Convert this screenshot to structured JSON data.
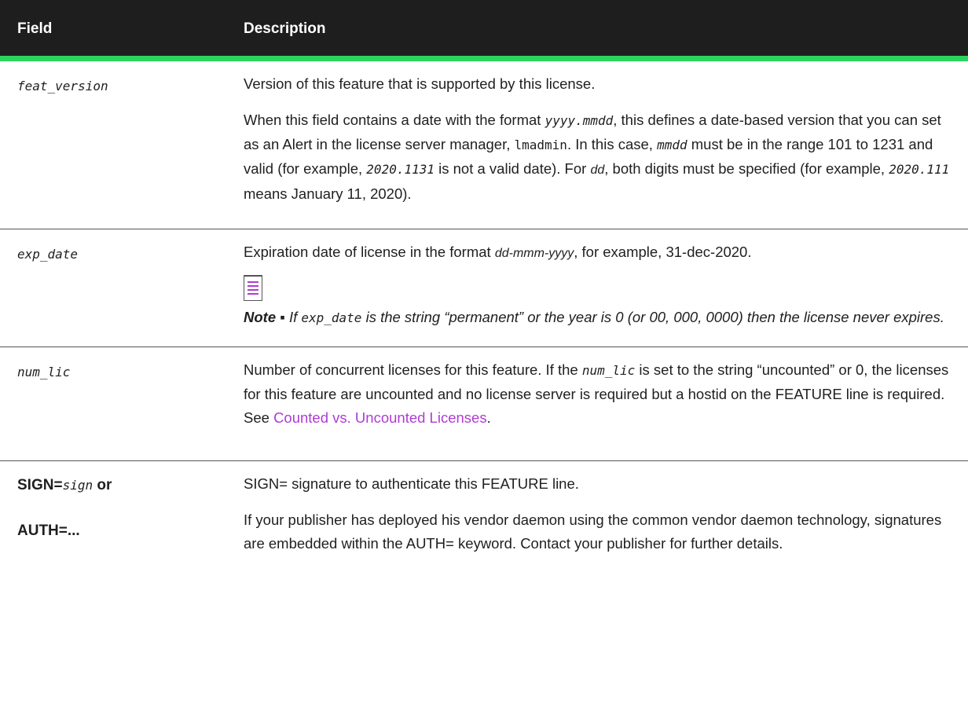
{
  "header": {
    "col_field": "Field",
    "col_description": "Description"
  },
  "rows": {
    "feat_version": {
      "field": "feat_version",
      "desc1": "Version of this feature that is supported by this license.",
      "desc2": {
        "a": "When this field contains a date with the format ",
        "fmt": "yyyy.mmdd",
        "b": ", this defines a date-based version that you can set as an Alert in the license server manager, ",
        "lmadmin": "lmadmin",
        "c": ". In this case, ",
        "mmdd": "mmdd",
        "d": "  must be in the range 101 to 1231 and valid (for example, ",
        "ex1": "2020.1131",
        "e": " is not a valid date). For ",
        "dd": "dd",
        "f": ", both digits must be specified (for example, ",
        "ex2": "2020.111",
        "g": "  means January 11, 2020)."
      }
    },
    "exp_date": {
      "field": "exp_date",
      "desc_a": "Expiration date of license in the format ",
      "fmt": "dd-mmm-yyyy",
      "desc_b": ", for example, 31-dec-2020.",
      "note_label": "Note ▪",
      "note_a": " If ",
      "note_code": "exp_date",
      "note_b": " is the string “permanent” or the year is 0 (or 00, 000, 0000) then the license never expires."
    },
    "num_lic": {
      "field": "num_lic",
      "a": "Number of concurrent licenses for this feature. If the ",
      "code": "num_lic",
      "b": " is set to the string “uncounted” or 0, the licenses for this feature are uncounted and no license server is required but a hostid on the FEATURE line is required. See ",
      "link": "Counted vs. Uncounted Licenses",
      "c": "."
    },
    "sign": {
      "field_a": "SIGN=",
      "field_b": "sign",
      "field_c": " or",
      "field2": "AUTH=...",
      "desc1": "SIGN= signature to authenticate this FEATURE line.",
      "desc2": "If your publisher has deployed his vendor daemon using the common vendor daemon technology, signatures are embedded within the AUTH= keyword. Contact your publisher for further details."
    }
  }
}
